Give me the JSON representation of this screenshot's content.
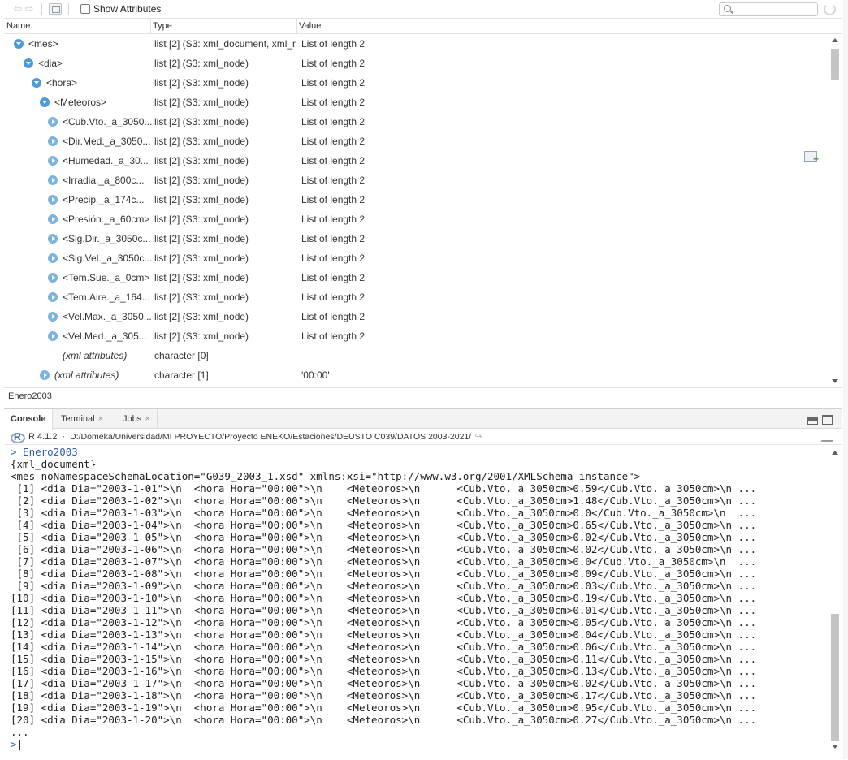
{
  "viewer": {
    "show_attributes_label": "Show Attributes",
    "search_placeholder": "",
    "columns": {
      "name": "Name",
      "type": "Type",
      "value": "Value"
    },
    "rows": [
      {
        "indent": 12,
        "toggle": "open",
        "name": "<mes>",
        "type": "list [2] (S3: xml_document, xml_n",
        "value": "List of length 2",
        "italic": false
      },
      {
        "indent": 24,
        "toggle": "open",
        "name": "<dia>",
        "type": "list [2] (S3: xml_node)",
        "value": "List of length 2",
        "italic": false
      },
      {
        "indent": 34,
        "toggle": "open",
        "name": "<hora>",
        "type": "list [2] (S3: xml_node)",
        "value": "List of length 2",
        "italic": false
      },
      {
        "indent": 44,
        "toggle": "open",
        "name": "<Meteoros>",
        "type": "list [2] (S3: xml_node)",
        "value": "List of length 2",
        "italic": false
      },
      {
        "indent": 54,
        "toggle": "closed",
        "name": "<Cub.Vto._a_3050...",
        "type": "list [2] (S3: xml_node)",
        "value": "List of length 2",
        "italic": false
      },
      {
        "indent": 54,
        "toggle": "closed",
        "name": "<Dir.Med._a_3050...",
        "type": "list [2] (S3: xml_node)",
        "value": "List of length 2",
        "italic": false
      },
      {
        "indent": 54,
        "toggle": "closed",
        "name": "<Humedad._a_30...",
        "type": "list [2] (S3: xml_node)",
        "value": "List of length 2",
        "italic": false
      },
      {
        "indent": 54,
        "toggle": "closed",
        "name": "<Irradia._a_800c...",
        "type": "list [2] (S3: xml_node)",
        "value": "List of length 2",
        "italic": false
      },
      {
        "indent": 54,
        "toggle": "closed",
        "name": "<Precip._a_174c...",
        "type": "list [2] (S3: xml_node)",
        "value": "List of length 2",
        "italic": false
      },
      {
        "indent": 54,
        "toggle": "closed",
        "name": "<Presión._a_60cm>",
        "type": "list [2] (S3: xml_node)",
        "value": "List of length 2",
        "italic": false
      },
      {
        "indent": 54,
        "toggle": "closed",
        "name": "<Sig.Dir._a_3050c...",
        "type": "list [2] (S3: xml_node)",
        "value": "List of length 2",
        "italic": false
      },
      {
        "indent": 54,
        "toggle": "closed",
        "name": "<Sig.Vel._a_3050c...",
        "type": "list [2] (S3: xml_node)",
        "value": "List of length 2",
        "italic": false
      },
      {
        "indent": 54,
        "toggle": "closed",
        "name": "<Tem.Sue._a_0cm>",
        "type": "list [2] (S3: xml_node)",
        "value": "List of length 2",
        "italic": false
      },
      {
        "indent": 54,
        "toggle": "closed",
        "name": "<Tem.Aire._a_164...",
        "type": "list [2] (S3: xml_node)",
        "value": "List of length 2",
        "italic": false
      },
      {
        "indent": 54,
        "toggle": "closed",
        "name": "<Vel.Max._a_3050...",
        "type": "list [2] (S3: xml_node)",
        "value": "List of length 2",
        "italic": false
      },
      {
        "indent": 54,
        "toggle": "closed",
        "name": "<Vel.Med._a_305...",
        "type": "list [2] (S3: xml_node)",
        "value": "List of length 2",
        "italic": false
      },
      {
        "indent": 72,
        "toggle": "none",
        "name": "(xml attributes)",
        "type": "character [0]",
        "value": "",
        "italic": true
      },
      {
        "indent": 44,
        "toggle": "closed",
        "name": "(xml attributes)",
        "type": "character [1]",
        "value": "'00:00'",
        "italic": true
      }
    ],
    "status": "Enero2003"
  },
  "console": {
    "tabs": [
      {
        "label": "Console",
        "active": true,
        "closable": false
      },
      {
        "label": "Terminal",
        "active": false,
        "closable": true
      },
      {
        "label": "Jobs",
        "active": false,
        "closable": true
      }
    ],
    "r_version": "R 4.1.2",
    "separator": "·",
    "path": "D:/Domeka/Universidad/MI PROYECTO/Proyecto ENEKO/Estaciones/DEUSTO C039/DATOS 2003-2021/",
    "lines": [
      {
        "text": "> Enero2003",
        "prompt": true
      },
      {
        "text": "{xml_document}",
        "prompt": false
      },
      {
        "text": "<mes noNamespaceSchemaLocation=\"G039_2003_1.xsd\" xmlns:xsi=\"http://www.w3.org/2001/XMLSchema-instance\">",
        "prompt": false
      },
      {
        "text": " [1] <dia Dia=\"2003-1-01\">\\n  <hora Hora=\"00:00\">\\n    <Meteoros>\\n      <Cub.Vto._a_3050cm>0.59</Cub.Vto._a_3050cm>\\n ...",
        "prompt": false
      },
      {
        "text": " [2] <dia Dia=\"2003-1-02\">\\n  <hora Hora=\"00:00\">\\n    <Meteoros>\\n      <Cub.Vto._a_3050cm>1.48</Cub.Vto._a_3050cm>\\n ...",
        "prompt": false
      },
      {
        "text": " [3] <dia Dia=\"2003-1-03\">\\n  <hora Hora=\"00:00\">\\n    <Meteoros>\\n      <Cub.Vto._a_3050cm>0.0</Cub.Vto._a_3050cm>\\n  ...",
        "prompt": false
      },
      {
        "text": " [4] <dia Dia=\"2003-1-04\">\\n  <hora Hora=\"00:00\">\\n    <Meteoros>\\n      <Cub.Vto._a_3050cm>0.65</Cub.Vto._a_3050cm>\\n ...",
        "prompt": false
      },
      {
        "text": " [5] <dia Dia=\"2003-1-05\">\\n  <hora Hora=\"00:00\">\\n    <Meteoros>\\n      <Cub.Vto._a_3050cm>0.02</Cub.Vto._a_3050cm>\\n ...",
        "prompt": false
      },
      {
        "text": " [6] <dia Dia=\"2003-1-06\">\\n  <hora Hora=\"00:00\">\\n    <Meteoros>\\n      <Cub.Vto._a_3050cm>0.02</Cub.Vto._a_3050cm>\\n ...",
        "prompt": false
      },
      {
        "text": " [7] <dia Dia=\"2003-1-07\">\\n  <hora Hora=\"00:00\">\\n    <Meteoros>\\n      <Cub.Vto._a_3050cm>0.0</Cub.Vto._a_3050cm>\\n  ...",
        "prompt": false
      },
      {
        "text": " [8] <dia Dia=\"2003-1-08\">\\n  <hora Hora=\"00:00\">\\n    <Meteoros>\\n      <Cub.Vto._a_3050cm>0.09</Cub.Vto._a_3050cm>\\n ...",
        "prompt": false
      },
      {
        "text": " [9] <dia Dia=\"2003-1-09\">\\n  <hora Hora=\"00:00\">\\n    <Meteoros>\\n      <Cub.Vto._a_3050cm>0.03</Cub.Vto._a_3050cm>\\n ...",
        "prompt": false
      },
      {
        "text": "[10] <dia Dia=\"2003-1-10\">\\n  <hora Hora=\"00:00\">\\n    <Meteoros>\\n      <Cub.Vto._a_3050cm>0.19</Cub.Vto._a_3050cm>\\n ...",
        "prompt": false
      },
      {
        "text": "[11] <dia Dia=\"2003-1-11\">\\n  <hora Hora=\"00:00\">\\n    <Meteoros>\\n      <Cub.Vto._a_3050cm>0.01</Cub.Vto._a_3050cm>\\n ...",
        "prompt": false
      },
      {
        "text": "[12] <dia Dia=\"2003-1-12\">\\n  <hora Hora=\"00:00\">\\n    <Meteoros>\\n      <Cub.Vto._a_3050cm>0.05</Cub.Vto._a_3050cm>\\n ...",
        "prompt": false
      },
      {
        "text": "[13] <dia Dia=\"2003-1-13\">\\n  <hora Hora=\"00:00\">\\n    <Meteoros>\\n      <Cub.Vto._a_3050cm>0.04</Cub.Vto._a_3050cm>\\n ...",
        "prompt": false
      },
      {
        "text": "[14] <dia Dia=\"2003-1-14\">\\n  <hora Hora=\"00:00\">\\n    <Meteoros>\\n      <Cub.Vto._a_3050cm>0.06</Cub.Vto._a_3050cm>\\n ...",
        "prompt": false
      },
      {
        "text": "[15] <dia Dia=\"2003-1-15\">\\n  <hora Hora=\"00:00\">\\n    <Meteoros>\\n      <Cub.Vto._a_3050cm>0.11</Cub.Vto._a_3050cm>\\n ...",
        "prompt": false
      },
      {
        "text": "[16] <dia Dia=\"2003-1-16\">\\n  <hora Hora=\"00:00\">\\n    <Meteoros>\\n      <Cub.Vto._a_3050cm>0.13</Cub.Vto._a_3050cm>\\n ...",
        "prompt": false
      },
      {
        "text": "[17] <dia Dia=\"2003-1-17\">\\n  <hora Hora=\"00:00\">\\n    <Meteoros>\\n      <Cub.Vto._a_3050cm>0.02</Cub.Vto._a_3050cm>\\n ...",
        "prompt": false
      },
      {
        "text": "[18] <dia Dia=\"2003-1-18\">\\n  <hora Hora=\"00:00\">\\n    <Meteoros>\\n      <Cub.Vto._a_3050cm>0.17</Cub.Vto._a_3050cm>\\n ...",
        "prompt": false
      },
      {
        "text": "[19] <dia Dia=\"2003-1-19\">\\n  <hora Hora=\"00:00\">\\n    <Meteoros>\\n      <Cub.Vto._a_3050cm>0.95</Cub.Vto._a_3050cm>\\n ...",
        "prompt": false
      },
      {
        "text": "[20] <dia Dia=\"2003-1-20\">\\n  <hora Hora=\"00:00\">\\n    <Meteoros>\\n      <Cub.Vto._a_3050cm>0.27</Cub.Vto._a_3050cm>\\n ...",
        "prompt": false
      },
      {
        "text": "...",
        "prompt": false
      },
      {
        "text": ">",
        "prompt": true,
        "cursor": true
      }
    ]
  }
}
